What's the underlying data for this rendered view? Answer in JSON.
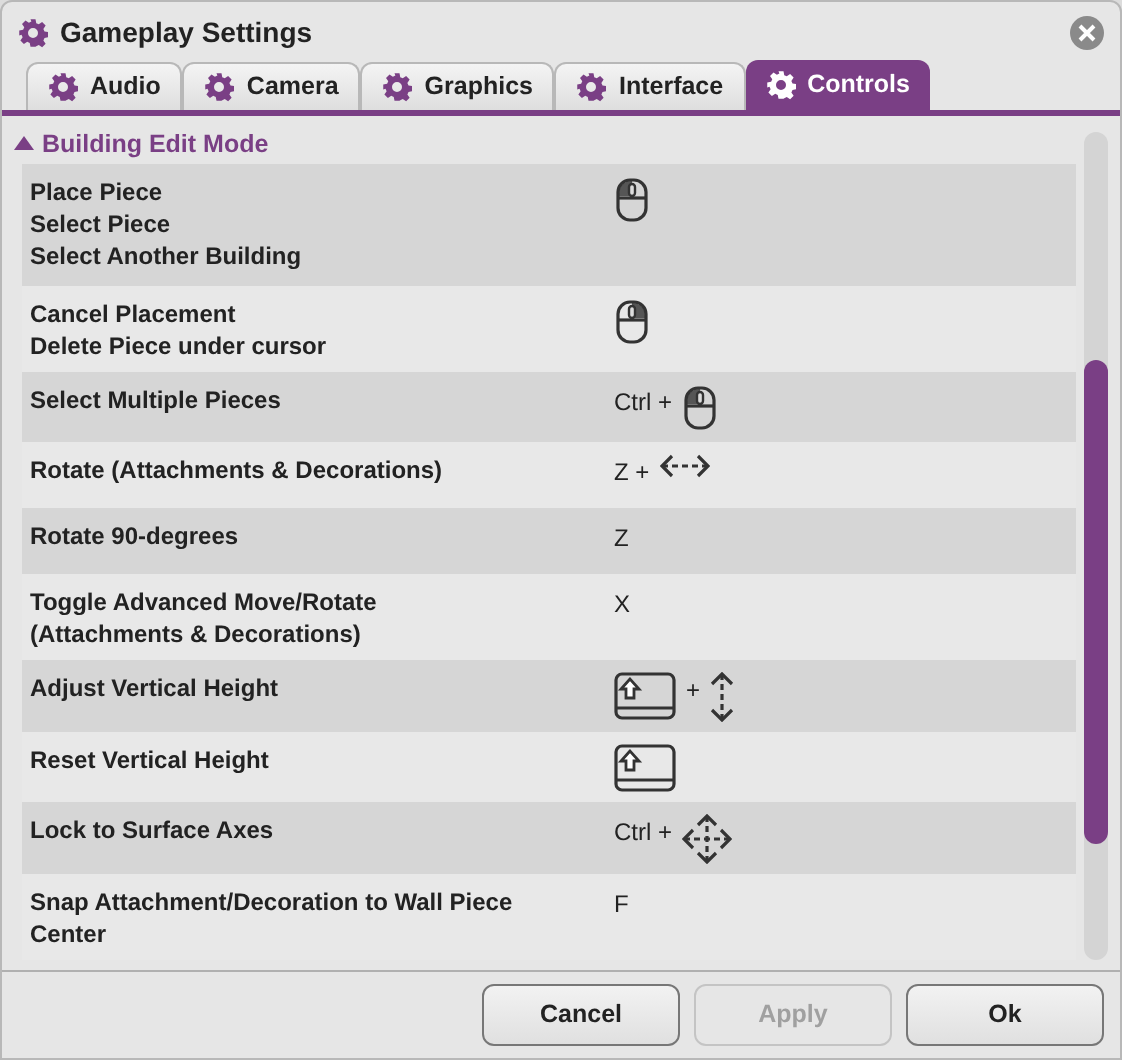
{
  "window": {
    "title": "Gameplay Settings"
  },
  "tabs": [
    {
      "label": "Audio",
      "selected": false
    },
    {
      "label": "Camera",
      "selected": false
    },
    {
      "label": "Graphics",
      "selected": false
    },
    {
      "label": "Interface",
      "selected": false
    },
    {
      "label": "Controls",
      "selected": true
    }
  ],
  "section": {
    "title": "Building Edit Mode",
    "expanded": true
  },
  "bindings": [
    {
      "lines": [
        "Place Piece",
        "Select Piece",
        "Select Another Building"
      ],
      "keys": [
        {
          "kind": "mouse-left"
        }
      ]
    },
    {
      "lines": [
        "Cancel Placement",
        "Delete Piece under cursor"
      ],
      "keys": [
        {
          "kind": "mouse-right"
        }
      ]
    },
    {
      "lines": [
        "Select Multiple Pieces"
      ],
      "keys": [
        {
          "kind": "text",
          "text": "Ctrl +"
        },
        {
          "kind": "mouse-left"
        }
      ]
    },
    {
      "lines": [
        "Rotate (Attachments & Decorations)"
      ],
      "keys": [
        {
          "kind": "text",
          "text": "Z +"
        },
        {
          "kind": "arrows-h"
        }
      ]
    },
    {
      "lines": [
        "Rotate 90-degrees"
      ],
      "keys": [
        {
          "kind": "text",
          "text": "Z"
        }
      ]
    },
    {
      "lines": [
        "Toggle Advanced Move/Rotate",
        "(Attachments & Decorations)"
      ],
      "keys": [
        {
          "kind": "text",
          "text": "X"
        }
      ]
    },
    {
      "lines": [
        "Adjust Vertical Height"
      ],
      "keys": [
        {
          "kind": "shift"
        },
        {
          "kind": "text",
          "text": "+"
        },
        {
          "kind": "arrows-v"
        }
      ]
    },
    {
      "lines": [
        "Reset Vertical Height"
      ],
      "keys": [
        {
          "kind": "shift"
        }
      ]
    },
    {
      "lines": [
        "Lock to Surface Axes"
      ],
      "keys": [
        {
          "kind": "text",
          "text": "Ctrl +"
        },
        {
          "kind": "arrows-4"
        }
      ]
    },
    {
      "lines": [
        "Snap Attachment/Decoration to Wall Piece",
        "Center"
      ],
      "keys": [
        {
          "kind": "text",
          "text": "F"
        }
      ]
    }
  ],
  "buttons": [
    {
      "label": "Cancel",
      "disabled": false
    },
    {
      "label": "Apply",
      "disabled": true
    },
    {
      "label": "Ok",
      "disabled": false
    }
  ]
}
